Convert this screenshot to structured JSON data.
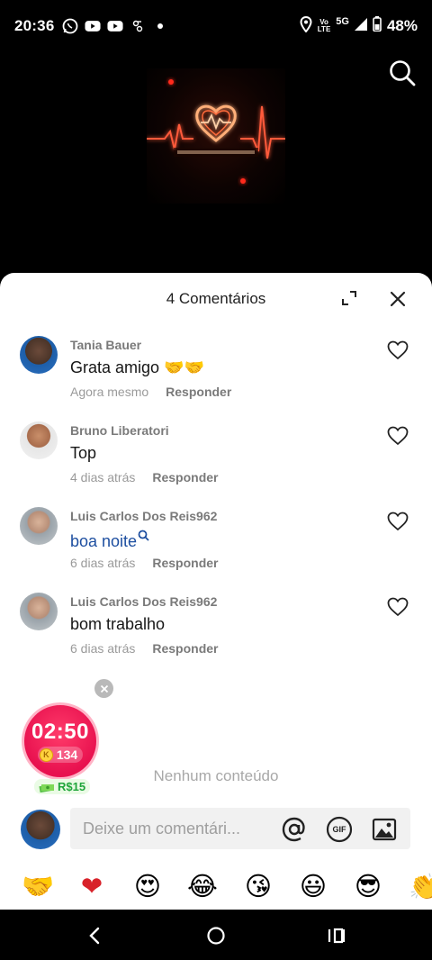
{
  "status_bar": {
    "time": "20:36",
    "left_icons": [
      "whatsapp-icon",
      "youtube-icon",
      "youtube-icon",
      "app-icon",
      "dot-icon"
    ],
    "network_top": "Vo",
    "network_bottom": "LTE",
    "network_5g": "5G",
    "battery": "48%"
  },
  "video": {
    "thumbnail": "heartbeat-glowing-heart-image"
  },
  "sheet": {
    "title": "4 Comentários",
    "comments": [
      {
        "user": "Tania Bauer",
        "text": "Grata amigo 🤝🤝",
        "time": "Agora mesmo",
        "reply": "Responder",
        "is_link": false
      },
      {
        "user": "Bruno Liberatori",
        "text": "Top",
        "time": "4 dias atrás",
        "reply": "Responder",
        "is_link": false
      },
      {
        "user": "Luis Carlos Dos Reis962",
        "text": "boa noite",
        "time": "6 dias atrás",
        "reply": "Responder",
        "is_link": true
      },
      {
        "user": "Luis Carlos Dos Reis962",
        "text": "bom trabalho",
        "time": "6 dias atrás",
        "reply": "Responder",
        "is_link": false
      }
    ],
    "empty_text": "Nenhum conteúdo"
  },
  "timer": {
    "time": "02:50",
    "coins": "134",
    "coin_letter": "K",
    "reward": "R$15"
  },
  "input": {
    "placeholder": "Deixe um comentári...",
    "gif_label": "GIF"
  },
  "emojis": [
    "🤝",
    "❤",
    "😍",
    "😂",
    "😘",
    "😃",
    "😎",
    "👏"
  ],
  "colors": {
    "accent_link": "#1e4fa0",
    "timer_pink": "#e8114f",
    "reward_green": "#1fa53a"
  }
}
